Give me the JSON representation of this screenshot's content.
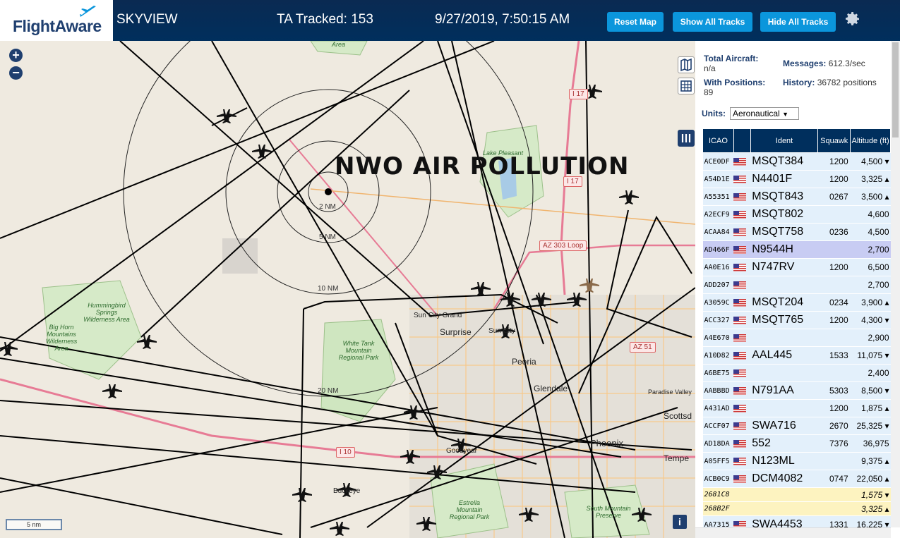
{
  "header": {
    "brand": "FlightAware",
    "app_title": "SKYVIEW",
    "tracked": "TA Tracked: 153",
    "datetime": "9/27/2019, 7:50:15 AM",
    "buttons": {
      "reset": "Reset Map",
      "show": "Show All Tracks",
      "hide": "Hide All Tracks"
    }
  },
  "map": {
    "overlay_text": "NWO AIR POLLUTION",
    "range_rings": [
      "2 NM",
      "5 NM",
      "10 NM",
      "20 NM"
    ],
    "places": [
      "Surprise",
      "Sun City Grand",
      "Sun City",
      "Peoria",
      "Glendale",
      "Phoenix",
      "Tempe",
      "Scottsd",
      "Paradise Valley",
      "Goodyear",
      "Buckeye"
    ],
    "parks": [
      "Area",
      "Lake Pleasant",
      "Hummingbird Springs Wilderness Area",
      "Big Horn Mountains Wilderness Area",
      "White Tank Mountain Regional Park",
      "Estrella Mountain Regional Park",
      "South Mountain Preserve"
    ],
    "shields": [
      "I 17",
      "I 17",
      "AZ 303 Loop",
      "AZ 51",
      "I 10"
    ],
    "scale": "5 nm",
    "info": "i"
  },
  "stats": {
    "total_label": "Total Aircraft:",
    "total_value": "n/a",
    "messages_label": "Messages:",
    "messages_value": "612.3/sec",
    "positions_label": "With Positions:",
    "positions_value": "89",
    "history_label": "History:",
    "history_value": "36782 positions"
  },
  "units": {
    "label": "Units:",
    "selected": "Aeronautical"
  },
  "table": {
    "headers": [
      "ICAO",
      "",
      "Ident",
      "Squawk",
      "Altitude (ft)"
    ],
    "rows": [
      {
        "icao": "ACE0DF",
        "ident": "MSQT384",
        "squawk": "1200",
        "alt": "4,500 ▾"
      },
      {
        "icao": "A54D1E",
        "ident": "N4401F",
        "squawk": "1200",
        "alt": "3,325 ▴"
      },
      {
        "icao": "A55351",
        "ident": "MSQT843",
        "squawk": "0267",
        "alt": "3,500 ▴"
      },
      {
        "icao": "A2ECF9",
        "ident": "MSQT802",
        "squawk": "",
        "alt": "4,600"
      },
      {
        "icao": "ACAA84",
        "ident": "MSQT758",
        "squawk": "0236",
        "alt": "4,500"
      },
      {
        "icao": "AD466F",
        "ident": "N9544H",
        "squawk": "",
        "alt": "2,700"
      },
      {
        "icao": "AA0E16",
        "ident": "N747RV",
        "squawk": "1200",
        "alt": "6,500"
      },
      {
        "icao": "ADD207",
        "ident": "",
        "squawk": "",
        "alt": "2,700"
      },
      {
        "icao": "A3059C",
        "ident": "MSQT204",
        "squawk": "0234",
        "alt": "3,900 ▴"
      },
      {
        "icao": "ACC327",
        "ident": "MSQT765",
        "squawk": "1200",
        "alt": "4,300 ▾"
      },
      {
        "icao": "A4E670",
        "ident": "",
        "squawk": "",
        "alt": "2,900"
      },
      {
        "icao": "A10D82",
        "ident": "AAL445",
        "squawk": "1533",
        "alt": "11,075 ▾"
      },
      {
        "icao": "A6BE75",
        "ident": "",
        "squawk": "",
        "alt": "2,400"
      },
      {
        "icao": "AABBBD",
        "ident": "N791AA",
        "squawk": "5303",
        "alt": "8,500 ▾"
      },
      {
        "icao": "A431AD",
        "ident": "",
        "squawk": "1200",
        "alt": "1,875 ▴"
      },
      {
        "icao": "ACCF07",
        "ident": "SWA716",
        "squawk": "2670",
        "alt": "25,325 ▾"
      },
      {
        "icao": "AD18DA",
        "ident": "552",
        "squawk": "7376",
        "alt": "36,975"
      },
      {
        "icao": "A05FF5",
        "ident": "N123ML",
        "squawk": "",
        "alt": "9,375 ▴"
      },
      {
        "icao": "ACB0C9",
        "ident": "DCM4082",
        "squawk": "0747",
        "alt": "22,050 ▴"
      },
      {
        "icao": "2681C8",
        "ident": "",
        "squawk": "",
        "alt": "1,575 ▾"
      },
      {
        "icao": "268B2F",
        "ident": "",
        "squawk": "",
        "alt": "3,325 ▴"
      },
      {
        "icao": "AA7315",
        "ident": "SWA4453",
        "squawk": "1331",
        "alt": "16,225 ▾"
      }
    ]
  },
  "colors": {
    "header": "#002f5d",
    "button": "#0b96dc",
    "row": "#e3f0fb",
    "selected": "#c8ccf3",
    "mlat": "#fdf3c0"
  }
}
